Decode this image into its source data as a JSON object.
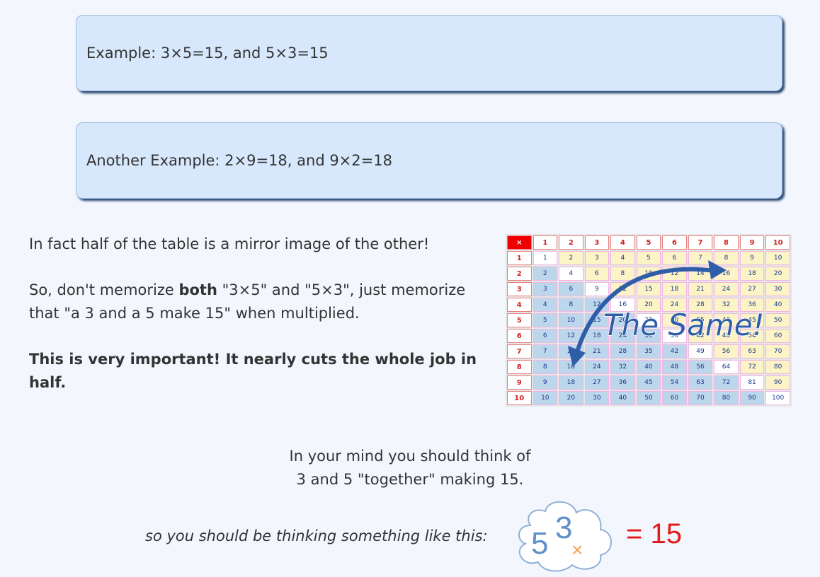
{
  "examples": {
    "first": "Example: 3×5=15, and 5×3=15",
    "second": "Another Example: 2×9=18, and 9×2=18"
  },
  "mirror": {
    "line": "In fact half of the table is a mirror image of the other!",
    "advice_pre": "So, don't memorize ",
    "advice_bold": "both",
    "advice_post": " \"3×5\" and \"5×3\", just memorize that \"a 3 and a 5 make 15\" when multiplied.",
    "important": "This is very important! It nearly cuts the whole job in half."
  },
  "table": {
    "corner": "×",
    "size": 10,
    "overlay_text": "The Same!",
    "colors": {
      "upper": "#fcf3c6",
      "lower": "#bcd6ec",
      "diagonal": "#ffffff",
      "header": "#d21f1f",
      "arrow": "#2f5ea8"
    }
  },
  "mind": {
    "line1": "In your mind you should think of",
    "line2": "3 and 5 \"together\" making 15."
  },
  "thinking": {
    "label": "so you should be thinking something like this:",
    "a": "5",
    "b": "3",
    "op": "×",
    "result": "= 15"
  }
}
